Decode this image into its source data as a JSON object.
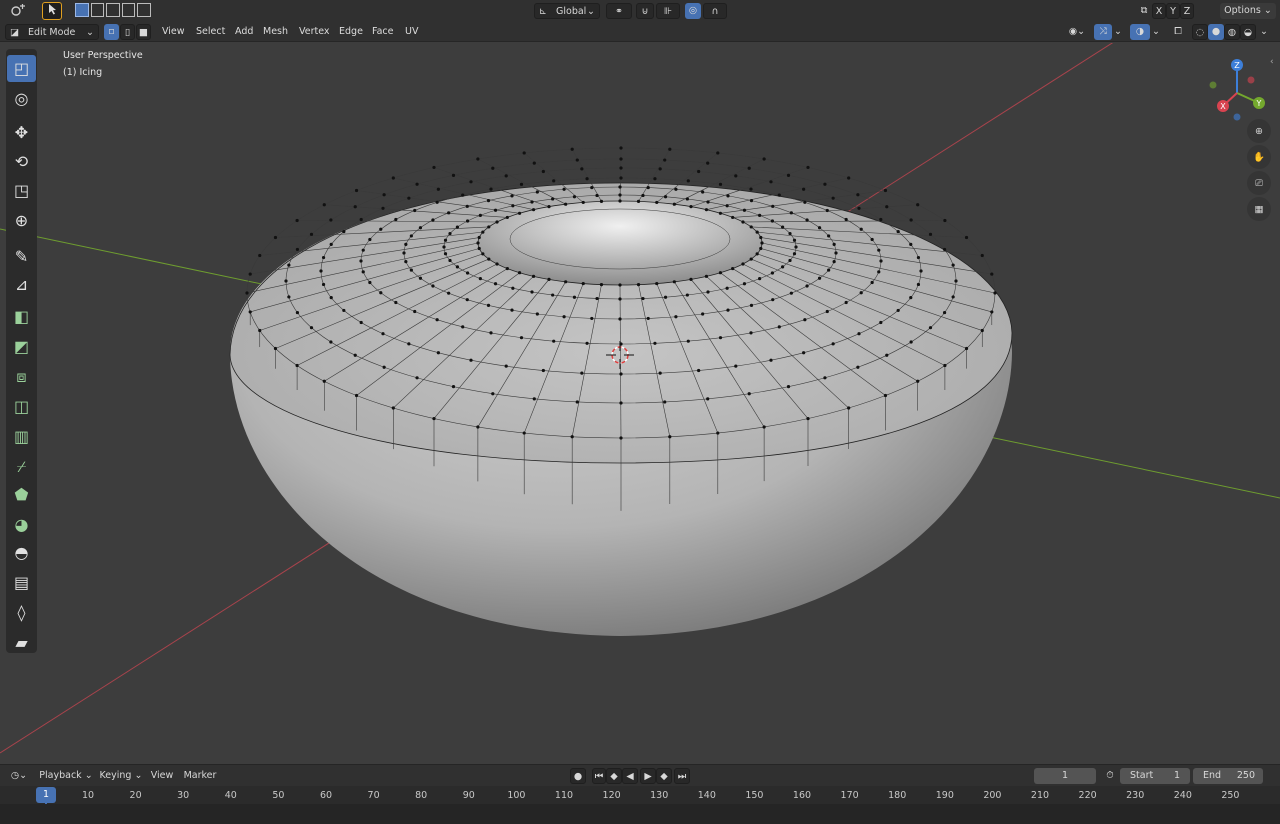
{
  "header": {
    "mode": "Edit Mode",
    "orientation": "Global",
    "options": "Options",
    "axes": [
      "X",
      "Y",
      "Z"
    ]
  },
  "menu": [
    "View",
    "Select",
    "Add",
    "Mesh",
    "Vertex",
    "Edge",
    "Face",
    "UV"
  ],
  "viewport": {
    "perspective_label": "User Perspective",
    "object_label": "(1) Icing"
  },
  "gizmo": {
    "x": "X",
    "y": "Y",
    "z": "Z"
  },
  "toolbar_icons": [
    "select-box-icon",
    "cursor-icon",
    "move-icon",
    "rotate-icon",
    "scale-icon",
    "transform-icon",
    "annotate-icon",
    "measure-icon",
    "add-cube-icon",
    "extrude-region-icon",
    "inset-faces-icon",
    "bevel-icon",
    "loop-cut-icon",
    "knife-icon",
    "poly-build-icon",
    "spin-icon",
    "smooth-icon",
    "edge-slide-icon",
    "shrink-fatten-icon",
    "shear-icon",
    "rip-region-icon"
  ],
  "timeline": {
    "menus": [
      "Playback",
      "Keying",
      "View",
      "Marker"
    ],
    "current_frame": "1",
    "start_label": "Start",
    "start_value": "1",
    "end_label": "End",
    "end_value": "250",
    "ruler_ticks": [
      "1",
      "10",
      "20",
      "30",
      "40",
      "50",
      "60",
      "70",
      "80",
      "90",
      "100",
      "110",
      "120",
      "130",
      "140",
      "150",
      "160",
      "170",
      "180",
      "190",
      "200",
      "210",
      "220",
      "230",
      "240",
      "250"
    ]
  },
  "colors": {
    "accent": "#4772b3",
    "x_axis": "#b4444e",
    "y_axis": "#74a82e",
    "z_axis": "#3d7fd9"
  }
}
